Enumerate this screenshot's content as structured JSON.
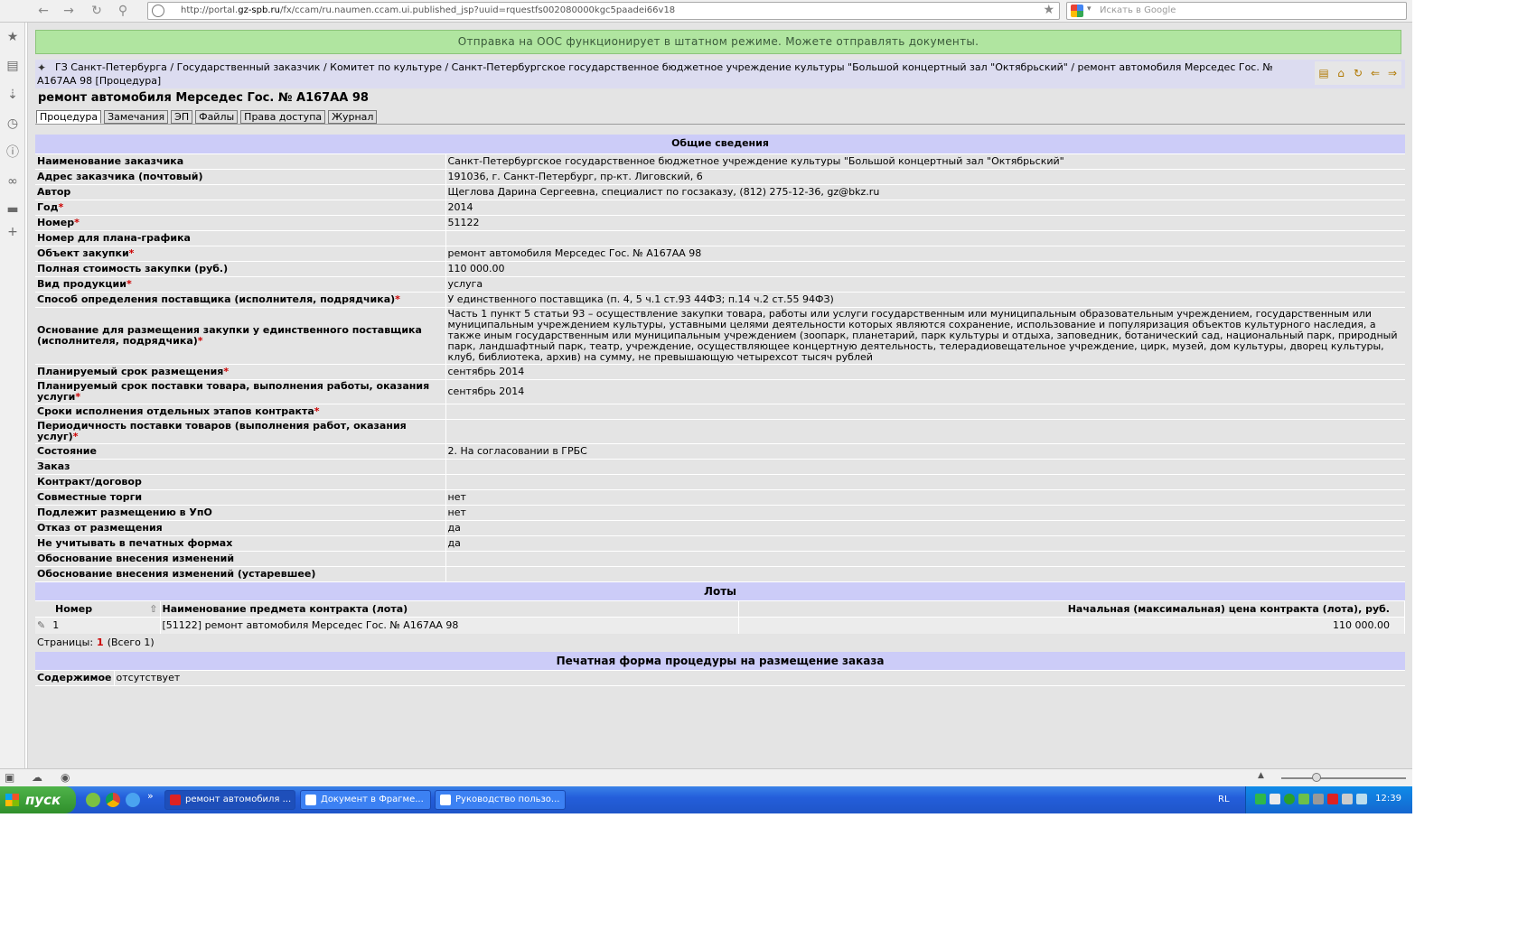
{
  "browser": {
    "url_prefix": "http://portal.",
    "url_domain": "gz-spb.ru",
    "url_rest": "/fx/ccam/ru.naumen.ccam.ui.published_jsp?uuid=rquestfs002080000kgc5paadei66v18",
    "search_placeholder": "Искать в Google"
  },
  "notice": "Отправка на ООС функционирует в штатном режиме. Можете отправлять документы.",
  "breadcrumb": "ГЗ Санкт-Петербурга / Государственный заказчик / Комитет по культуре / Санкт-Петербургское государственное бюджетное учреждение культуры \"Большой концертный зал \"Октябрьский\" / ремонт автомобиля Мерседес Гос. № А167АА 98 [Процедура]",
  "page_title": "ремонт автомобиля Мерседес Гос. № А167АА 98",
  "tabs": [
    "Процедура",
    "Замечания",
    "ЭП",
    "Файлы",
    "Права доступа",
    "Журнал"
  ],
  "general": {
    "heading": "Общие сведения",
    "rows": [
      {
        "label": "Наименование заказчика",
        "value": "Санкт-Петербургское государственное бюджетное учреждение культуры \"Большой концертный зал \"Октябрьский\"",
        "req": false
      },
      {
        "label": "Адрес заказчика (почтовый)",
        "value": "191036, г. Санкт-Петербург, пр-кт. Лиговский, 6",
        "req": false
      },
      {
        "label": "Автор",
        "value": "Щеглова Дарина Сергеевна, специалист по госзаказу, (812) 275-12-36, gz@bkz.ru",
        "req": false
      },
      {
        "label": "Год",
        "value": "2014",
        "req": true
      },
      {
        "label": "Номер",
        "value": "51122",
        "req": true
      },
      {
        "label": "Номер для плана-графика",
        "value": "",
        "req": false
      },
      {
        "label": "Объект закупки",
        "value": "ремонт автомобиля Мерседес Гос. № А167АА 98",
        "req": true
      },
      {
        "label": "Полная стоимость закупки (руб.)",
        "value": "110 000.00",
        "req": false
      },
      {
        "label": "Вид продукции",
        "value": "услуга",
        "req": true
      },
      {
        "label": "Способ определения поставщика (исполнителя, подрядчика)",
        "value": "У единственного поставщика (п. 4, 5 ч.1 ст.93 44ФЗ; п.14 ч.2 ст.55 94ФЗ)",
        "req": true
      },
      {
        "label": "Основание для размещения закупки у единственного поставщика (исполнителя, подрядчика)",
        "value": "Часть 1 пункт 5 статьи 93 – осуществление закупки товара, работы или услуги государственным или муниципальным образовательным учреждением, государственным или муниципальным учреждением культуры, уставными целями деятельности которых являются сохранение, использование и популяризация объектов культурного наследия, а также иным государственным или муниципальным учреждением (зоопарк, планетарий, парк культуры и отдыха, заповедник, ботанический сад, национальный парк, природный парк, ландшафтный парк, театр, учреждение, осуществляющее концертную деятельность, телерадиовещательное учреждение, цирк, музей, дом культуры, дворец культуры, клуб, библиотека, архив) на сумму, не превышающую четырехсот тысяч рублей",
        "req": true
      },
      {
        "label": "Планируемый срок размещения",
        "value": "сентябрь 2014",
        "req": true
      },
      {
        "label": "Планируемый срок поставки товара, выполнения работы, оказания услуги",
        "value": "сентябрь 2014",
        "req": true
      },
      {
        "label": "Сроки исполнения отдельных этапов контракта",
        "value": "",
        "req": true
      },
      {
        "label": "Периодичность поставки товаров (выполнения работ, оказания услуг)",
        "value": "",
        "req": true
      },
      {
        "label": "Состояние",
        "value": "2. На согласовании в ГРБС",
        "req": false
      },
      {
        "label": "Заказ",
        "value": "",
        "req": false
      },
      {
        "label": "Контракт/договор",
        "value": "",
        "req": false
      },
      {
        "label": "Совместные торги",
        "value": "нет",
        "req": false
      },
      {
        "label": "Подлежит размещению в УпО",
        "value": "нет",
        "req": false
      },
      {
        "label": "Отказ от размещения",
        "value": "да",
        "req": false
      },
      {
        "label": "Не учитывать в печатных формах",
        "value": "да",
        "req": false
      },
      {
        "label": "Обоснование внесения изменений",
        "value": "",
        "req": false
      },
      {
        "label": "Обоснование внесения изменений (устаревшее)",
        "value": "",
        "req": false
      }
    ]
  },
  "lots": {
    "heading": "Лоты",
    "col_number": "Номер",
    "col_name": "Наименование предмета контракта (лота)",
    "col_price": "Начальная (максимальная) цена контракта (лота), руб.",
    "rows": [
      {
        "number": "1",
        "name": "[51122] ремонт автомобиля Мерседес Гос. № А167АА 98",
        "price": "110 000.00"
      }
    ],
    "pages_label": "Страницы:",
    "current_page": "1",
    "total": "(Всего 1)"
  },
  "print_form": {
    "heading": "Печатная форма процедуры на размещение заказа",
    "label": "Содержимое",
    "value": "отсутствует"
  },
  "taskbar": {
    "start": "пуск",
    "tasks": [
      "ремонт автомобиля ...",
      "Документ в Фрагме...",
      "Руководство пользо..."
    ],
    "lang": "RL",
    "clock": "12:39"
  },
  "colors": {
    "notice_bg": "#b0e5a0",
    "section_bg": "#ccccf8",
    "breadcrumb_bg": "#dcdcf0",
    "required": "#cc0000"
  }
}
